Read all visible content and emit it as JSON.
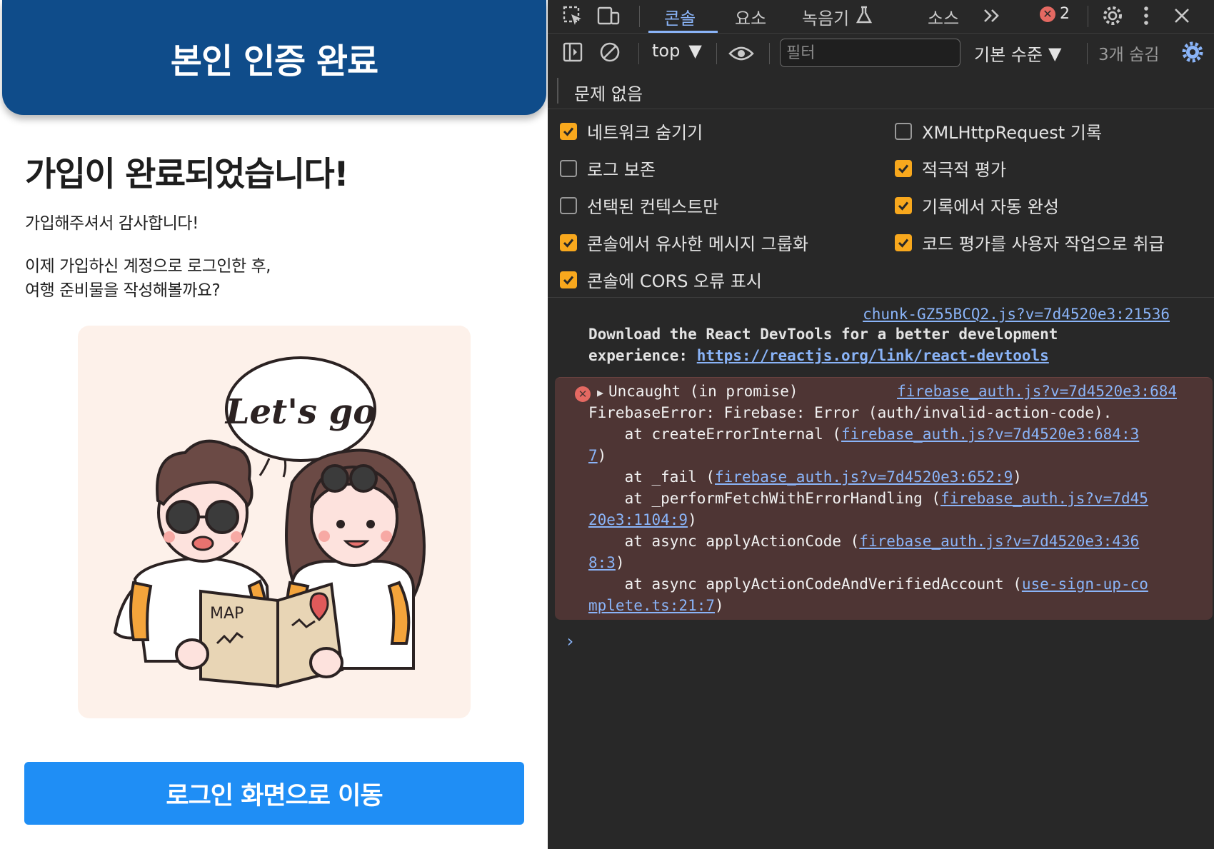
{
  "app": {
    "header_title": "본인 인증 완료",
    "heading": "가입이 완료되었습니다!",
    "thanks": "가입해주셔서 감사합니다!",
    "next_line1": "이제 가입하신 계정으로 로그인한 후,",
    "next_line2": "여행 준비물을 작성해볼까요?",
    "illustration": {
      "bubble_text": "Let's go",
      "map_label": "MAP"
    },
    "button_label": "로그인 화면으로 이동",
    "colors": {
      "header": "#0f4c8a",
      "button": "#1f8ef5",
      "illustration_bg": "#fdf1ea"
    }
  },
  "devtools": {
    "tabs": [
      {
        "label": "콘솔",
        "active": true
      },
      {
        "label": "요소",
        "active": false
      },
      {
        "label": "녹음기",
        "active": false
      },
      {
        "label": "소스",
        "active": false
      }
    ],
    "error_count": "2",
    "toolbar": {
      "context": "top",
      "filter_placeholder": "필터",
      "level": "기본 수준",
      "hidden": "3개 숨김"
    },
    "issues": "문제 없음",
    "settings": [
      {
        "label": "네트워크 숨기기",
        "checked": true
      },
      {
        "label": "XMLHttpRequest 기록",
        "checked": false
      },
      {
        "label": "로그 보존",
        "checked": false
      },
      {
        "label": "적극적 평가",
        "checked": true
      },
      {
        "label": "선택된 컨텍스트만",
        "checked": false
      },
      {
        "label": "기록에서 자동 완성",
        "checked": true
      },
      {
        "label": "콘솔에서 유사한 메시지 그룹화",
        "checked": true
      },
      {
        "label": "코드 평가를 사용자 작업으로 취급",
        "checked": true
      },
      {
        "label": "콘솔에 CORS 오류 표시",
        "checked": true
      }
    ],
    "console": {
      "info": {
        "source": "chunk-GZ55BCQ2.js?v=7d4520e3:21536",
        "line1": "Download the React DevTools for a better development",
        "line2_prefix": "experience: ",
        "line2_link": "https://reactjs.org/link/react-devtools"
      },
      "error": {
        "title": "Uncaught (in promise)",
        "source": "firebase_auth.js?v=7d4520e3:684",
        "message": "FirebaseError: Firebase: Error (auth/invalid-action-code).",
        "s1_prefix": "    at createErrorInternal (",
        "s1_link_a": "firebase_auth.js?v=7d4520e3:684:3",
        "s1_link_b": "7",
        "s2_prefix": "    at _fail (",
        "s2_link": "firebase_auth.js?v=7d4520e3:652:9",
        "s3_prefix": "    at _performFetchWithErrorHandling (",
        "s3_link_a": "firebase_auth.js?v=7d45",
        "s3_link_b": "20e3:1104:9",
        "s4_prefix": "    at async applyActionCode (",
        "s4_link_a": "firebase_auth.js?v=7d4520e3:436",
        "s4_link_b": "8:3",
        "s5_prefix": "    at async applyActionCodeAndVerifiedAccount (",
        "s5_link_a": "use-sign-up-co",
        "s5_link_b": "mplete.ts:21:7",
        "close_paren": ")"
      },
      "prompt": "›"
    }
  }
}
